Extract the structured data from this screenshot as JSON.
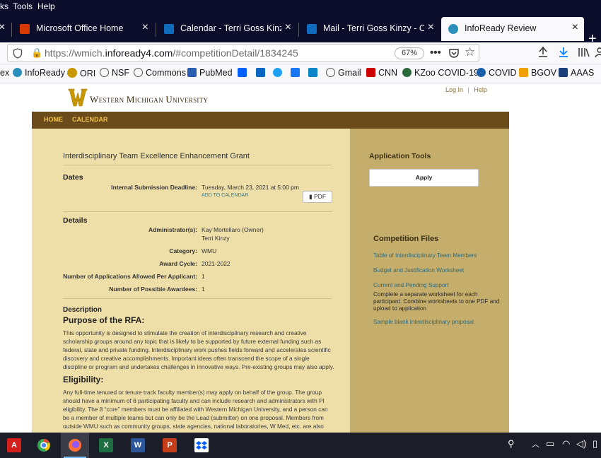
{
  "menubar": {
    "partial": "ks",
    "tools": "Tools",
    "help": "Help"
  },
  "tabs": [
    {
      "label": "Microsoft Office Home",
      "icon": "office-icon",
      "color": "#d83b01"
    },
    {
      "label": "Calendar - Terri Goss Kinzy - Ou",
      "icon": "calendar-icon",
      "color": "#0f6cbd"
    },
    {
      "label": "Mail - Terri Goss Kinzy - Outloo",
      "icon": "outlook-icon",
      "color": "#0f6cbd"
    },
    {
      "label": "InfoReady Review",
      "icon": "infoready-icon",
      "color": "#2c8ebb",
      "active": true
    }
  ],
  "address": {
    "prefix": "https://wmich.",
    "domain": "infoready4.com",
    "path": "/#competitionDetail/1834245",
    "zoom": "67%"
  },
  "bookmarks": [
    {
      "label": "ex",
      "icon": ""
    },
    {
      "label": "InfoReady",
      "icon": "infoready-icon",
      "color": "#2c8ebb"
    },
    {
      "label": "ORI",
      "icon": "w-icon",
      "color": "#c99700"
    },
    {
      "label": "NSF",
      "icon": "globe-icon",
      "color": "#555"
    },
    {
      "label": "Commons",
      "icon": "globe-icon",
      "color": "#555"
    },
    {
      "label": "PubMed",
      "icon": "pubmed-icon",
      "color": "#2a5db0"
    },
    {
      "label": "",
      "icon": "dropbox-icon",
      "color": "#0061fe"
    },
    {
      "label": "",
      "icon": "linkedin-icon",
      "color": "#0a66c2"
    },
    {
      "label": "",
      "icon": "twitter-icon",
      "color": "#1da1f2"
    },
    {
      "label": "",
      "icon": "facebook-icon",
      "color": "#1877f2"
    },
    {
      "label": "",
      "icon": "chart-icon",
      "color": "#0a84c6"
    },
    {
      "label": "Gmail",
      "icon": "globe-icon",
      "color": "#555"
    },
    {
      "label": "CNN",
      "icon": "cnn-icon",
      "color": "#cc0000"
    },
    {
      "label": "KZoo COVID-19",
      "icon": "kzoo-icon",
      "color": "#2a6a3a"
    },
    {
      "label": "COVID",
      "icon": "covid-icon",
      "color": "#1a5fa8"
    },
    {
      "label": "BGOV",
      "icon": "bgov-icon",
      "color": "#f0a000"
    },
    {
      "label": "AAAS",
      "icon": "aaas-icon",
      "color": "#1c3f7a"
    }
  ],
  "site": {
    "logo_letter": "W",
    "university": "Western Michigan University",
    "login": "Log In",
    "sep": "|",
    "help": "Help",
    "nav": [
      "HOME",
      "CALENDAR"
    ]
  },
  "competition": {
    "title": "Interdisciplinary Team Excellence Enhancement Grant",
    "dates_heading": "Dates",
    "deadline_label": "Internal Submission Deadline:",
    "deadline_value": "Tuesday, March 23, 2021 at 5:00 pm",
    "add_to_calendar": "ADD TO CALENDAR",
    "pdf_label": "PDF",
    "details_heading": "Details",
    "details": [
      {
        "label": "Administrator(s):",
        "value": "Kay Mortellaro (Owner)",
        "value2": "Terri Kinzy"
      },
      {
        "label": "Category:",
        "value": "WMU"
      },
      {
        "label": "Award Cycle:",
        "value": "2021-2022"
      },
      {
        "label": "Number of Applications Allowed Per Applicant:",
        "value": "1"
      },
      {
        "label": "Number of Possible Awardees:",
        "value": "1"
      }
    ],
    "description_heading": "Description",
    "purpose_heading": "Purpose of the RFA:",
    "purpose_text": "This opportunity is designed to stimulate the creation of interdisciplinary research and creative scholarship groups around any topic that is likely to be supported by future external funding such as federal, state and private funding. Interdisciplinary work pushes fields forward and accelerates scientific discovery and creative accomplishments. Important ideas often transcend the scope of a single discipline or program and undertakes challenges in innovative ways. Pre-existing groups may also apply.",
    "eligibility_heading": "Eligibility:",
    "eligibility_text": "Any full-time tenured or tenure track faculty member(s) may apply on behalf of the group. The group should have a minimum of 8 participating faculty and can include research and administrators with PI eligibility. The 8 “core” members must be affiliated with Western Michigan University, and a person can be a member of multiple teams but can only be the Lead (submitter) on one proposal. Members from outside WMU such as community groups, state agencies, national laboratories, W Med, etc. are also allowed."
  },
  "sidebar": {
    "tools_heading": "Application Tools",
    "apply_label": "Apply",
    "files_heading": "Competition Files",
    "files": [
      "Table of Interdisciplinary Team Members",
      "Budget and Justification Worksheet",
      "Current and Pending Support",
      "Sample blank interdisciplinary proposal"
    ],
    "pending_note": "Complete a separate worksheet for each participant. Combine worksheets to one PDF and upload to application"
  },
  "taskbar": {
    "apps": [
      {
        "name": "acrobat-icon",
        "color": "#d4201c",
        "glyph": "A"
      },
      {
        "name": "chrome-icon",
        "color": "#34a853",
        "glyph": ""
      },
      {
        "name": "firefox-icon",
        "color": "#ff7139",
        "glyph": "",
        "active": true
      },
      {
        "name": "excel-icon",
        "color": "#1d6f42",
        "glyph": "X"
      },
      {
        "name": "word-icon",
        "color": "#2b579a",
        "glyph": "W"
      },
      {
        "name": "powerpoint-icon",
        "color": "#c43e1c",
        "glyph": "P"
      },
      {
        "name": "dropbox-icon",
        "color": "#ffffff",
        "glyph": ""
      }
    ]
  }
}
